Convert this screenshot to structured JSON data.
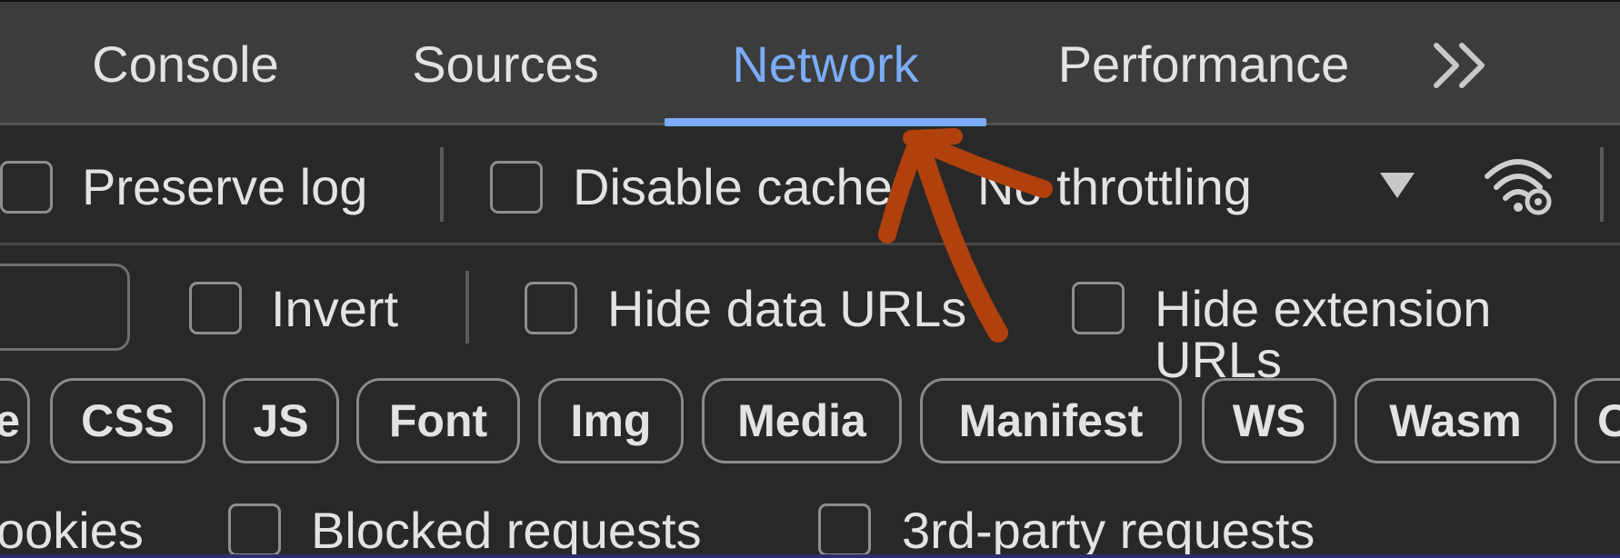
{
  "tabs": [
    {
      "label": "Console"
    },
    {
      "label": "Sources"
    },
    {
      "label": "Network"
    },
    {
      "label": "Performance"
    }
  ],
  "active_tab": "Network",
  "toolbar": {
    "preserve_log_label": "Preserve log",
    "disable_cache_label": "Disable cache",
    "throttling_value": "No throttling"
  },
  "filter_row": {
    "invert_label": "Invert",
    "hide_data_urls_label": "Hide data URLs",
    "hide_extension_urls_label": "Hide extension URLs"
  },
  "type_filters": [
    "e",
    "CSS",
    "JS",
    "Font",
    "Img",
    "Media",
    "Manifest",
    "WS",
    "Wasm",
    "O"
  ],
  "bottom_row": {
    "cookies_label": "ookies",
    "blocked_requests_label": "Blocked requests",
    "third_party_label": "3rd-party requests"
  },
  "colors": {
    "accent": "#7cacf8",
    "annotation_arrow": "#b0400c"
  },
  "icons": [
    "more-tabs-icon",
    "dropdown-caret-icon",
    "network-conditions-icon"
  ]
}
